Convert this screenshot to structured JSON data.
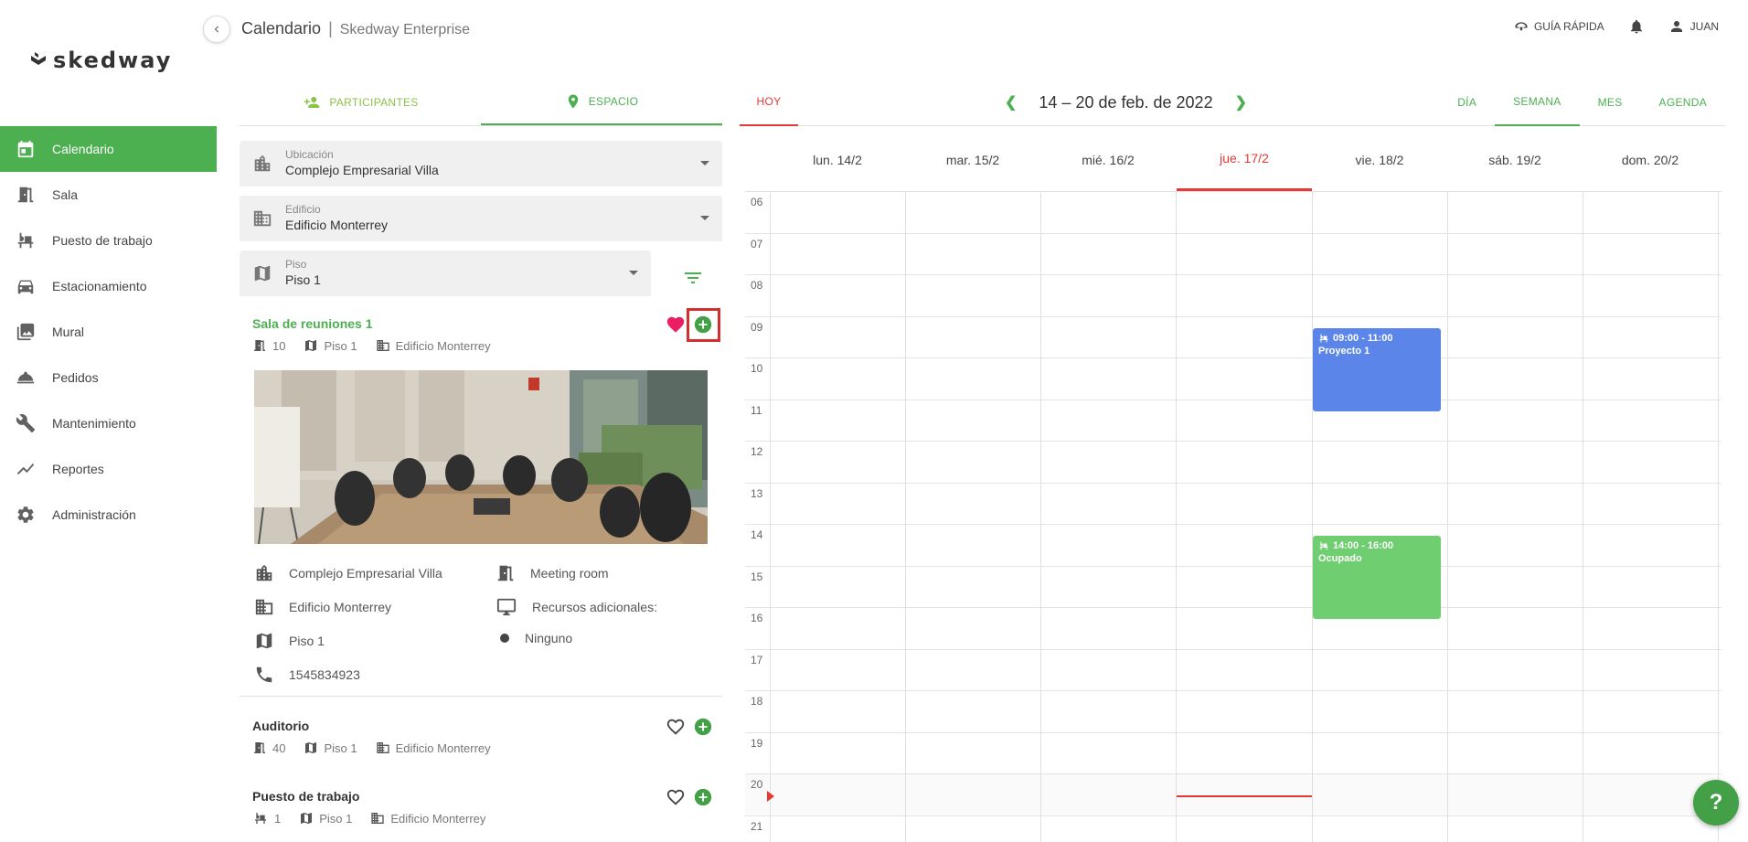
{
  "app": {
    "logo_text": "skedway",
    "title": "Calendario",
    "subtitle": "Skedway Enterprise"
  },
  "topbar": {
    "quick_guide": "GUÍA RÁPIDA",
    "user": "JUAN"
  },
  "sidebar": {
    "items": [
      {
        "label": "Calendario",
        "icon": "calendar-icon",
        "active": true
      },
      {
        "label": "Sala",
        "icon": "door-icon"
      },
      {
        "label": "Puesto de trabajo",
        "icon": "desk-chair-icon"
      },
      {
        "label": "Estacionamiento",
        "icon": "car-icon"
      },
      {
        "label": "Mural",
        "icon": "image-icon"
      },
      {
        "label": "Pedidos",
        "icon": "room-service-icon"
      },
      {
        "label": "Mantenimiento",
        "icon": "wrench-icon"
      },
      {
        "label": "Reportes",
        "icon": "trending-icon"
      },
      {
        "label": "Administración",
        "icon": "gear-icon"
      }
    ]
  },
  "left_panel": {
    "tabs": [
      {
        "label": "PARTICIPANTES",
        "icon": "person-add-icon"
      },
      {
        "label": "ESPACIO",
        "icon": "location-pin-icon",
        "active": true
      }
    ],
    "filters": {
      "location": {
        "label": "Ubicación",
        "value": "Complejo Empresarial Villa"
      },
      "building": {
        "label": "Edificio",
        "value": "Edificio Monterrey"
      },
      "floor": {
        "label": "Piso",
        "value": "Piso 1"
      }
    },
    "rooms": [
      {
        "name": "Sala de reuniones 1",
        "capacity": "10",
        "floor": "Piso 1",
        "building": "Edificio Monterrey",
        "favorite": true
      },
      {
        "name": "Auditorio",
        "capacity": "40",
        "floor": "Piso 1",
        "building": "Edificio Monterrey",
        "favorite": false
      },
      {
        "name": "Puesto de trabajo",
        "capacity": "1",
        "floor": "Piso 1",
        "building": "Edificio Monterrey",
        "favorite": false
      }
    ],
    "details": {
      "location": "Complejo Empresarial Villa",
      "building": "Edificio Monterrey",
      "floor": "Piso 1",
      "phone": "1545834923",
      "type": "Meeting room",
      "resources_label": "Recursos adicionales:",
      "resources_value": "Ninguno"
    }
  },
  "calendar": {
    "today_label": "HOY",
    "range": "14 – 20 de feb. de 2022",
    "views": [
      "DÍA",
      "SEMANA",
      "MES",
      "AGENDA"
    ],
    "active_view": "SEMANA",
    "days": [
      "lun. 14/2",
      "mar. 15/2",
      "mié. 16/2",
      "jue. 17/2",
      "vie. 18/2",
      "sáb. 19/2",
      "dom. 20/2"
    ],
    "today_index": 3,
    "hours": [
      "06",
      "07",
      "08",
      "09",
      "10",
      "11",
      "12",
      "13",
      "14",
      "15",
      "16",
      "17",
      "18",
      "19",
      "20",
      "21"
    ],
    "events": [
      {
        "time": "09:00 - 11:00",
        "title": "Proyecto 1",
        "color": "#5c85ea"
      },
      {
        "time": "14:00 - 16:00",
        "title": "Ocupado",
        "color": "#6fcf70"
      }
    ]
  },
  "help": {
    "label": "?"
  },
  "colors": {
    "accent": "#4caf50",
    "today": "#e53935",
    "event_blue": "#5c85ea",
    "event_green": "#6fcf70"
  }
}
